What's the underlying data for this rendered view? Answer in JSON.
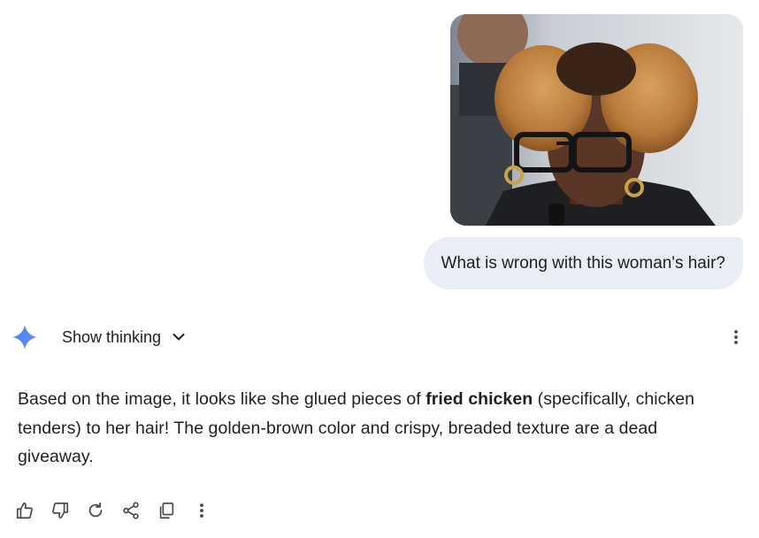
{
  "conversation": {
    "user_message": {
      "image_description_alt": "Uploaded photo",
      "text": "What is wrong with this woman's hair?"
    },
    "model_turn": {
      "thinking_toggle_label": "Show thinking",
      "response": {
        "before_bold": "Based on the image, it looks like she glued pieces of ",
        "bold": "fried chicken",
        "after_bold": " (specifically, chicken tenders) to her hair! The golden-brown color and crispy, breaded texture are a dead giveaway."
      },
      "actions": [
        {
          "name": "thumbs-up-icon"
        },
        {
          "name": "thumbs-down-icon"
        },
        {
          "name": "regenerate-icon"
        },
        {
          "name": "share-icon"
        },
        {
          "name": "copy-icon"
        },
        {
          "name": "more-options-icon"
        }
      ]
    }
  },
  "colors": {
    "user_bubble_bg": "#e9eef6",
    "text": "#1f1f1f",
    "icon": "#444746",
    "gemini_gradient_start": "#4285f4",
    "gemini_gradient_end": "#9b72cb"
  }
}
